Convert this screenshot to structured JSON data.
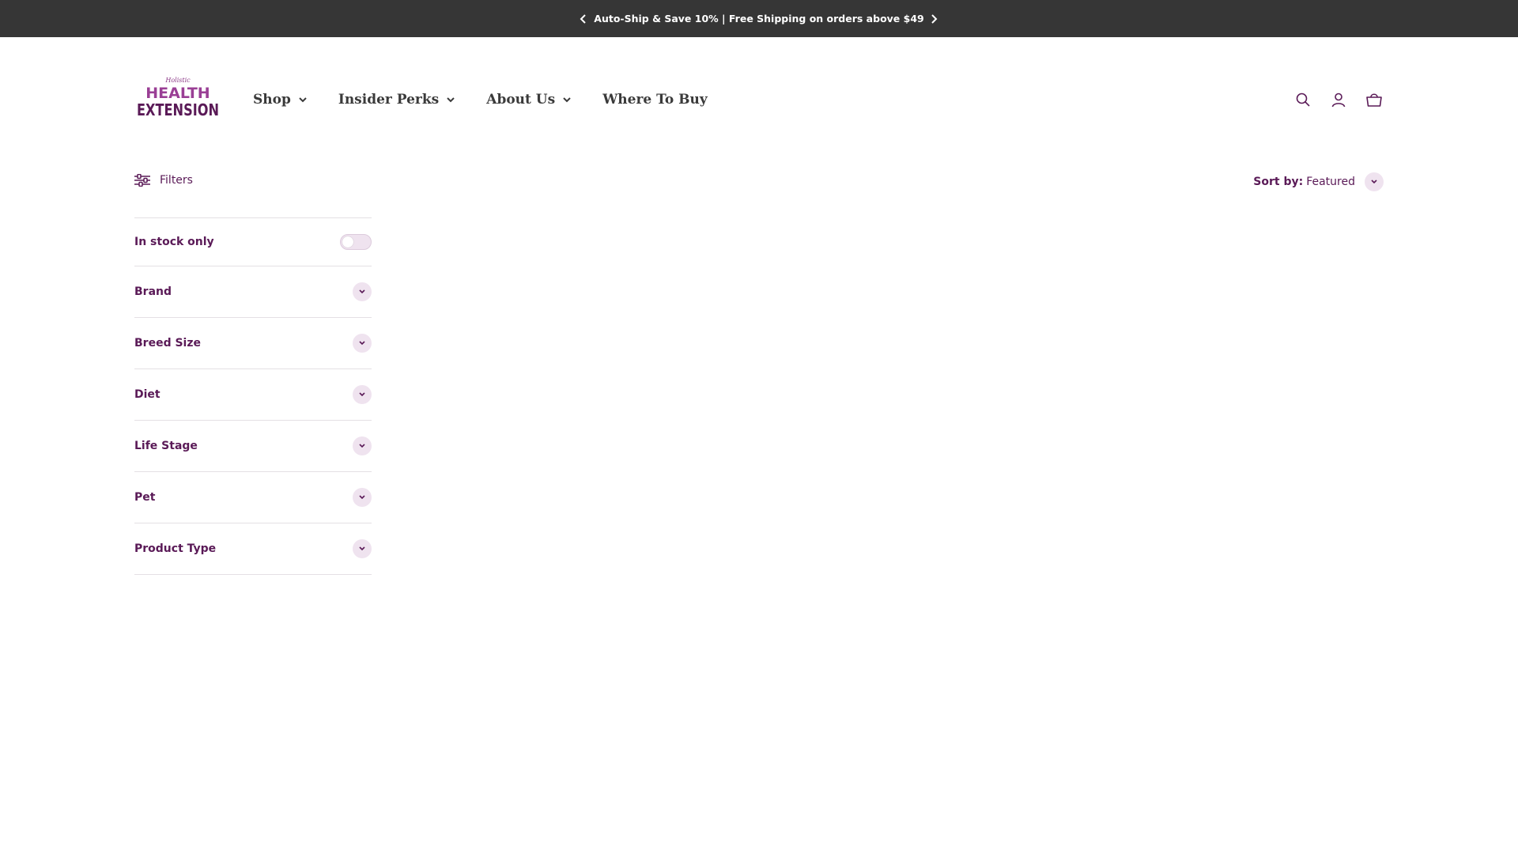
{
  "announcement": {
    "text": "Auto-Ship & Save 10% | Free Shipping on orders above $49",
    "prev_icon": "chevron-left-icon",
    "next_icon": "chevron-right-icon"
  },
  "header": {
    "logo": {
      "top_text": "Holistic",
      "line1": "HEALTH",
      "line2": "EXTENSION"
    },
    "nav": [
      {
        "label": "Shop",
        "has_dropdown": true
      },
      {
        "label": "Insider Perks",
        "has_dropdown": true
      },
      {
        "label": "About Us",
        "has_dropdown": true
      },
      {
        "label": "Where To Buy",
        "has_dropdown": false
      }
    ],
    "icons": [
      "search-icon",
      "account-icon",
      "cart-icon"
    ]
  },
  "toolbar": {
    "filters_label": "Filters",
    "sort_label": "Sort by:",
    "sort_value": "Featured"
  },
  "sidebar": {
    "in_stock_label": "In stock only",
    "in_stock_on": false,
    "facets": [
      "Brand",
      "Breed Size",
      "Diet",
      "Life Stage",
      "Pet",
      "Product Type"
    ]
  },
  "colors": {
    "brand_purple": "#5a1a57",
    "announcement_bg": "#363636",
    "chip_bg": "#efe3ef"
  }
}
